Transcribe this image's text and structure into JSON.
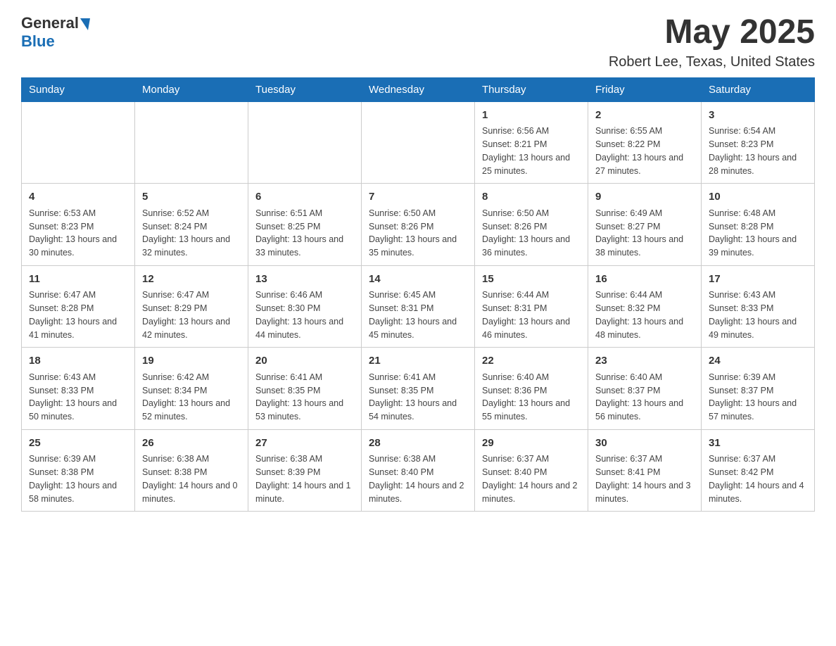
{
  "header": {
    "logo_general": "General",
    "logo_blue": "Blue",
    "title": "May 2025",
    "subtitle": "Robert Lee, Texas, United States"
  },
  "calendar": {
    "days_of_week": [
      "Sunday",
      "Monday",
      "Tuesday",
      "Wednesday",
      "Thursday",
      "Friday",
      "Saturday"
    ],
    "weeks": [
      [
        {
          "day": "",
          "info": ""
        },
        {
          "day": "",
          "info": ""
        },
        {
          "day": "",
          "info": ""
        },
        {
          "day": "",
          "info": ""
        },
        {
          "day": "1",
          "info": "Sunrise: 6:56 AM\nSunset: 8:21 PM\nDaylight: 13 hours and 25 minutes."
        },
        {
          "day": "2",
          "info": "Sunrise: 6:55 AM\nSunset: 8:22 PM\nDaylight: 13 hours and 27 minutes."
        },
        {
          "day": "3",
          "info": "Sunrise: 6:54 AM\nSunset: 8:23 PM\nDaylight: 13 hours and 28 minutes."
        }
      ],
      [
        {
          "day": "4",
          "info": "Sunrise: 6:53 AM\nSunset: 8:23 PM\nDaylight: 13 hours and 30 minutes."
        },
        {
          "day": "5",
          "info": "Sunrise: 6:52 AM\nSunset: 8:24 PM\nDaylight: 13 hours and 32 minutes."
        },
        {
          "day": "6",
          "info": "Sunrise: 6:51 AM\nSunset: 8:25 PM\nDaylight: 13 hours and 33 minutes."
        },
        {
          "day": "7",
          "info": "Sunrise: 6:50 AM\nSunset: 8:26 PM\nDaylight: 13 hours and 35 minutes."
        },
        {
          "day": "8",
          "info": "Sunrise: 6:50 AM\nSunset: 8:26 PM\nDaylight: 13 hours and 36 minutes."
        },
        {
          "day": "9",
          "info": "Sunrise: 6:49 AM\nSunset: 8:27 PM\nDaylight: 13 hours and 38 minutes."
        },
        {
          "day": "10",
          "info": "Sunrise: 6:48 AM\nSunset: 8:28 PM\nDaylight: 13 hours and 39 minutes."
        }
      ],
      [
        {
          "day": "11",
          "info": "Sunrise: 6:47 AM\nSunset: 8:28 PM\nDaylight: 13 hours and 41 minutes."
        },
        {
          "day": "12",
          "info": "Sunrise: 6:47 AM\nSunset: 8:29 PM\nDaylight: 13 hours and 42 minutes."
        },
        {
          "day": "13",
          "info": "Sunrise: 6:46 AM\nSunset: 8:30 PM\nDaylight: 13 hours and 44 minutes."
        },
        {
          "day": "14",
          "info": "Sunrise: 6:45 AM\nSunset: 8:31 PM\nDaylight: 13 hours and 45 minutes."
        },
        {
          "day": "15",
          "info": "Sunrise: 6:44 AM\nSunset: 8:31 PM\nDaylight: 13 hours and 46 minutes."
        },
        {
          "day": "16",
          "info": "Sunrise: 6:44 AM\nSunset: 8:32 PM\nDaylight: 13 hours and 48 minutes."
        },
        {
          "day": "17",
          "info": "Sunrise: 6:43 AM\nSunset: 8:33 PM\nDaylight: 13 hours and 49 minutes."
        }
      ],
      [
        {
          "day": "18",
          "info": "Sunrise: 6:43 AM\nSunset: 8:33 PM\nDaylight: 13 hours and 50 minutes."
        },
        {
          "day": "19",
          "info": "Sunrise: 6:42 AM\nSunset: 8:34 PM\nDaylight: 13 hours and 52 minutes."
        },
        {
          "day": "20",
          "info": "Sunrise: 6:41 AM\nSunset: 8:35 PM\nDaylight: 13 hours and 53 minutes."
        },
        {
          "day": "21",
          "info": "Sunrise: 6:41 AM\nSunset: 8:35 PM\nDaylight: 13 hours and 54 minutes."
        },
        {
          "day": "22",
          "info": "Sunrise: 6:40 AM\nSunset: 8:36 PM\nDaylight: 13 hours and 55 minutes."
        },
        {
          "day": "23",
          "info": "Sunrise: 6:40 AM\nSunset: 8:37 PM\nDaylight: 13 hours and 56 minutes."
        },
        {
          "day": "24",
          "info": "Sunrise: 6:39 AM\nSunset: 8:37 PM\nDaylight: 13 hours and 57 minutes."
        }
      ],
      [
        {
          "day": "25",
          "info": "Sunrise: 6:39 AM\nSunset: 8:38 PM\nDaylight: 13 hours and 58 minutes."
        },
        {
          "day": "26",
          "info": "Sunrise: 6:38 AM\nSunset: 8:38 PM\nDaylight: 14 hours and 0 minutes."
        },
        {
          "day": "27",
          "info": "Sunrise: 6:38 AM\nSunset: 8:39 PM\nDaylight: 14 hours and 1 minute."
        },
        {
          "day": "28",
          "info": "Sunrise: 6:38 AM\nSunset: 8:40 PM\nDaylight: 14 hours and 2 minutes."
        },
        {
          "day": "29",
          "info": "Sunrise: 6:37 AM\nSunset: 8:40 PM\nDaylight: 14 hours and 2 minutes."
        },
        {
          "day": "30",
          "info": "Sunrise: 6:37 AM\nSunset: 8:41 PM\nDaylight: 14 hours and 3 minutes."
        },
        {
          "day": "31",
          "info": "Sunrise: 6:37 AM\nSunset: 8:42 PM\nDaylight: 14 hours and 4 minutes."
        }
      ]
    ]
  }
}
